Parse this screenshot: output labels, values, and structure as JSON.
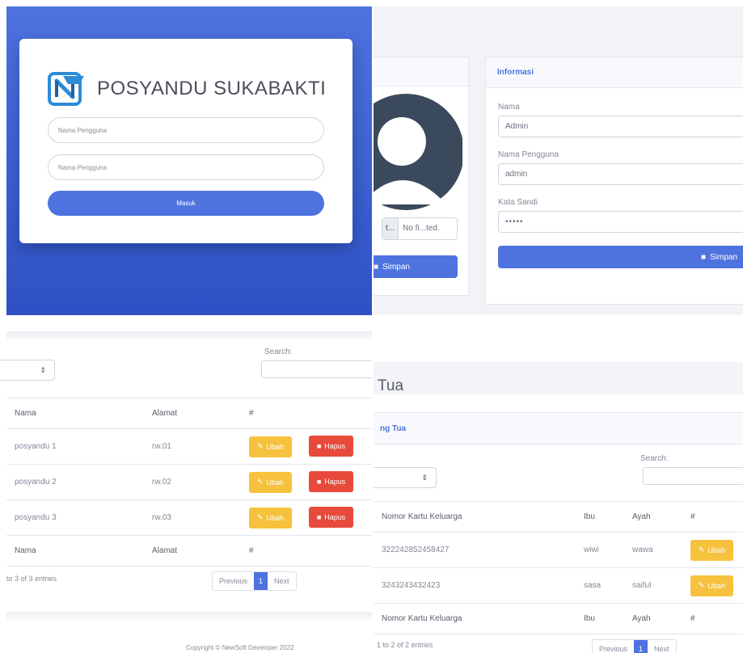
{
  "login": {
    "brand_title": "POSYANDU SUKABAKTI",
    "username_placeholder": "Nama Pengguna",
    "password_placeholder": "Nama Pengguna",
    "submit_label": "Masuk",
    "colors": {
      "accent": "#4e73df"
    }
  },
  "profile": {
    "file_button": "t...",
    "file_name": "No fi...ted.",
    "left_save_label": "Simpan",
    "card_title": "Informasi",
    "fields": [
      {
        "label": "Nama",
        "value": "Admin"
      },
      {
        "label": "Nama Pengguna",
        "value": "admin"
      },
      {
        "label": "Kata Sandi",
        "value": "•••••"
      }
    ],
    "save_label": "Simpan"
  },
  "posyandu_table": {
    "length_arrow": "⇕",
    "search_label": "Search:",
    "columns": [
      "Nama",
      "Alamat",
      "#"
    ],
    "rows": [
      {
        "nama": "posyandu 1",
        "alamat": "rw.01"
      },
      {
        "nama": "posyandu 2",
        "alamat": "rw.02"
      },
      {
        "nama": "posyandu 3",
        "alamat": "rw.03"
      }
    ],
    "edit_label": "Ubah",
    "delete_label": "Hapus",
    "footer_columns": [
      "Nama",
      "Alamat",
      "#"
    ],
    "entries_info": "to 3 of 3 entries",
    "pager": {
      "previous": "Previous",
      "current": "1",
      "next": "Next"
    },
    "copyright": "Copyright © NewSoft Developer 2022",
    "colors": {
      "edit": "#f6c23e",
      "delete": "#e74a3b"
    }
  },
  "ortu_table": {
    "page_title": "Tua",
    "card_title": "ng Tua",
    "length_arrow": "⇕",
    "search_label": "Search:",
    "columns": [
      "Nomor Kartu Keluarga",
      "Ibu",
      "Ayah",
      "#"
    ],
    "rows": [
      {
        "kk": "322242852458427",
        "ibu": "wiwi",
        "ayah": "wawa"
      },
      {
        "kk": "3243243432423",
        "ibu": "sasa",
        "ayah": "saiful"
      }
    ],
    "edit_label": "Ubah",
    "footer_columns": [
      "Nomor Kartu Keluarga",
      "Ibu",
      "Ayah",
      "#"
    ],
    "entries_info": "1 to 2 of 2 entries",
    "pager": {
      "previous": "Previous",
      "current": "1",
      "next": "Next"
    }
  }
}
